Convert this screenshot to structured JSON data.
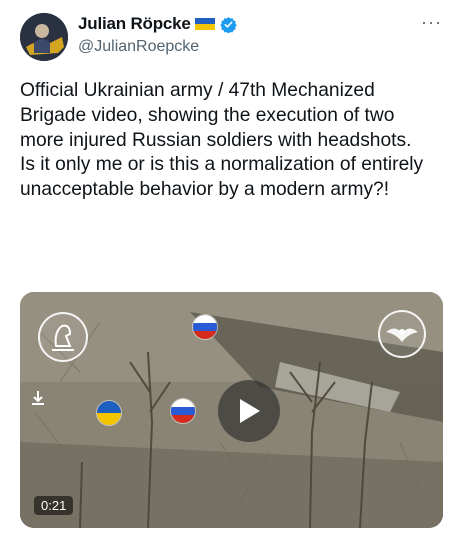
{
  "author": {
    "display_name": "Julian Röpcke",
    "handle": "@JulianRoepcke",
    "flag_icon": "ukraine-flag-icon",
    "verified_icon": "verified-badge-icon",
    "flag_colors": [
      "#1f5fbf",
      "#f2c500"
    ],
    "verified_color": "#1d9bf0"
  },
  "menu_icon": "more-options-icon",
  "tweet": {
    "paragraph_1": "Official Ukrainian army / 47th Mechanized Brigade video, showing the execution of two more injured Russian soldiers with headshots.",
    "paragraph_2": "Is it only me or is this a normalization of entirely unacceptable behavior by a modern army?!"
  },
  "media": {
    "type": "video",
    "duration": "0:21",
    "play_icon": "play-icon"
  }
}
